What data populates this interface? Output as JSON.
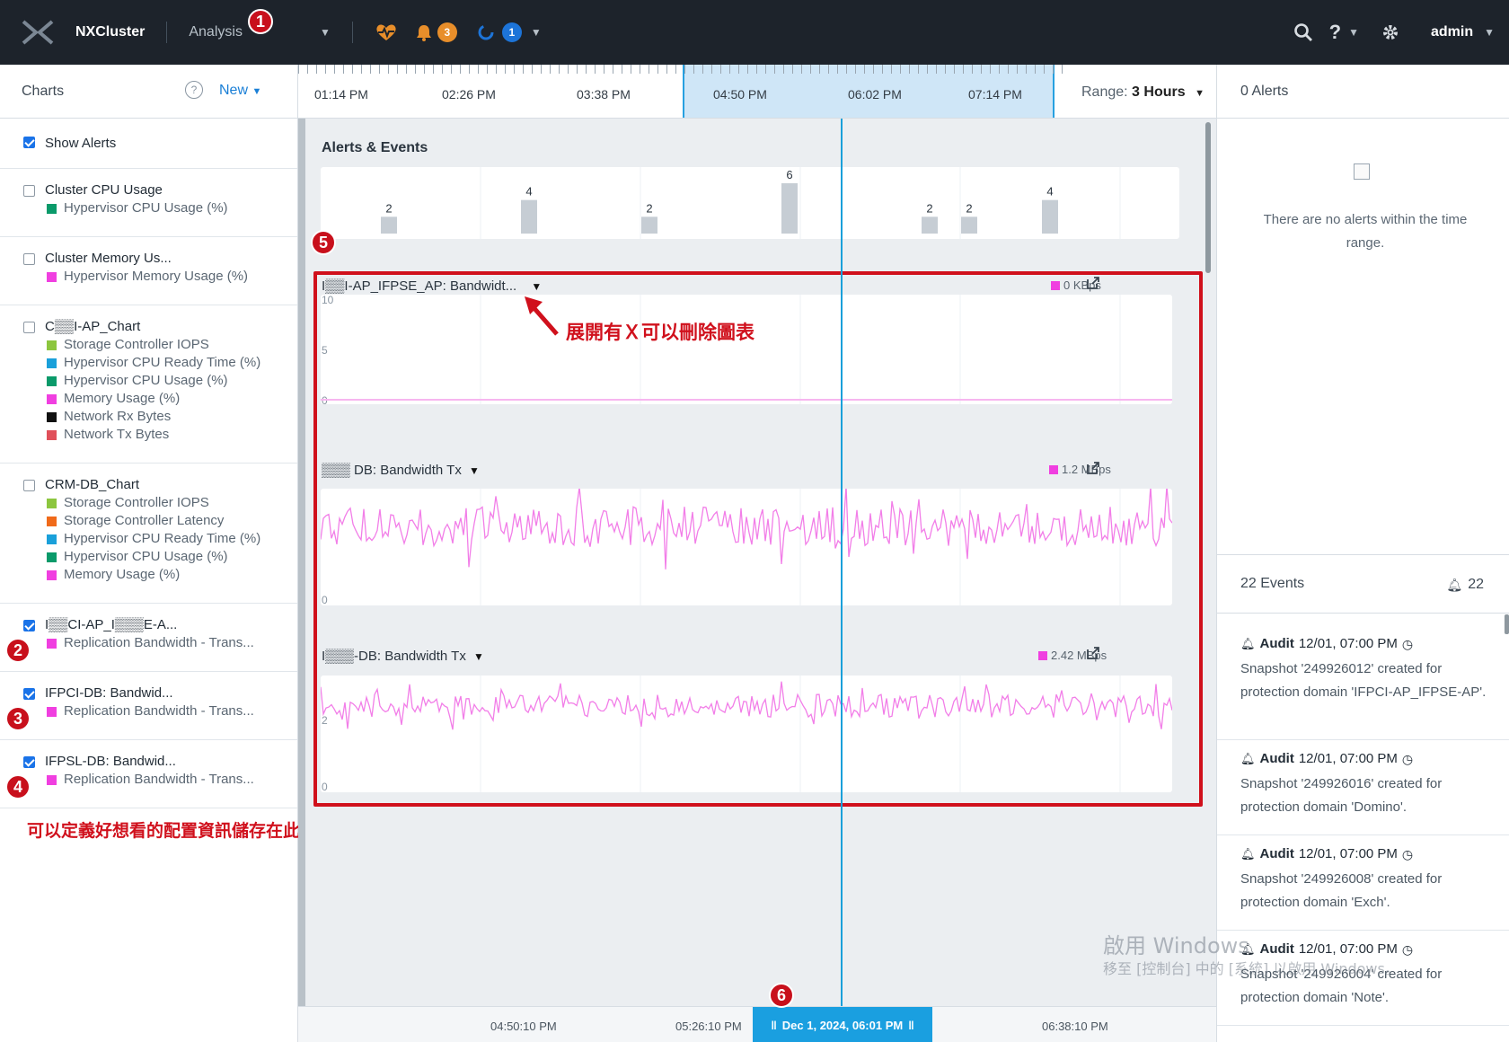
{
  "nav": {
    "cluster": "NXCluster",
    "section": "Analysis",
    "alerts_count": "3",
    "tasks_count": "1",
    "user": "admin",
    "colors": {
      "bg": "#1d232b",
      "alert_badge": "#e88e2a",
      "task_badge": "#1d74d8",
      "pulse": "#e88e2a"
    }
  },
  "callouts": [
    "1",
    "2",
    "3",
    "4",
    "5",
    "6"
  ],
  "sidebar": {
    "title": "Charts",
    "new_label": "New",
    "show_alerts": {
      "label": "Show Alerts",
      "checked": true
    },
    "groups": [
      {
        "title": "Cluster CPU Usage",
        "checked": false,
        "metrics": [
          {
            "label": "Hypervisor CPU Usage (%)",
            "color": "#0a9a6a"
          }
        ]
      },
      {
        "title": "Cluster Memory Us...",
        "checked": false,
        "metrics": [
          {
            "label": "Hypervisor Memory Usage (%)",
            "color": "#f03fe0"
          }
        ]
      },
      {
        "title": "C▒▒I-AP_Chart",
        "checked": false,
        "metrics": [
          {
            "label": "Storage Controller IOPS",
            "color": "#8cc63f"
          },
          {
            "label": "Hypervisor CPU Ready Time (%)",
            "color": "#1aa0da"
          },
          {
            "label": "Hypervisor CPU Usage (%)",
            "color": "#0a9a6a"
          },
          {
            "label": "Memory Usage (%)",
            "color": "#f03fe0"
          },
          {
            "label": "Network Rx Bytes",
            "color": "#111111"
          },
          {
            "label": "Network Tx Bytes",
            "color": "#e0505a"
          }
        ]
      },
      {
        "title": "CRM-DB_Chart",
        "checked": false,
        "metrics": [
          {
            "label": "Storage Controller IOPS",
            "color": "#8cc63f"
          },
          {
            "label": "Storage Controller Latency",
            "color": "#f06a1a"
          },
          {
            "label": "Hypervisor CPU Ready Time (%)",
            "color": "#1aa0da"
          },
          {
            "label": "Hypervisor CPU Usage (%)",
            "color": "#0a9a6a"
          },
          {
            "label": "Memory Usage (%)",
            "color": "#f03fe0"
          }
        ]
      },
      {
        "title": "I▒▒CI-AP_I▒▒▒E-A...",
        "checked": true,
        "metrics": [
          {
            "label": "Replication Bandwidth - Trans...",
            "color": "#f03fe0"
          }
        ]
      },
      {
        "title": "IFPCI-DB: Bandwid...",
        "checked": true,
        "metrics": [
          {
            "label": "Replication Bandwidth - Trans...",
            "color": "#f03fe0"
          }
        ]
      },
      {
        "title": "IFPSL-DB: Bandwid...",
        "checked": true,
        "metrics": [
          {
            "label": "Replication Bandwidth - Trans...",
            "color": "#f03fe0"
          }
        ]
      }
    ],
    "note": "可以定義好想看的配置資訊儲存在此，需要查看時再打勾"
  },
  "timeline": {
    "labels": [
      "01:14 PM",
      "02:26 PM",
      "03:38 PM",
      "04:50 PM",
      "06:02 PM",
      "07:14 PM"
    ],
    "range_label": "Range:",
    "range_value": "3 Hours"
  },
  "alerts_events": {
    "title": "Alerts & Events",
    "bars": [
      2,
      4,
      2,
      6,
      2,
      2,
      4
    ]
  },
  "charts": [
    {
      "title": "I▒▒I-AP_IFPSE_AP: Bandwidt...",
      "legend": "0 KBps",
      "ymax": "10",
      "ymid": "5",
      "ymin": "0"
    },
    {
      "title": "▒▒▒ DB: Bandwidth Tx",
      "legend": "1.2 MBps",
      "ymin": "0"
    },
    {
      "title": "I▒▒▒-DB: Bandwidth Tx",
      "legend": "2.42 MBps",
      "ymid": "2",
      "ymin": "0"
    }
  ],
  "annotation": "展開有Ｘ可以刪除圖表",
  "bottom_axis": {
    "labels": [
      "04:50:10 PM",
      "05:26:10 PM",
      "06:38:10 PM"
    ],
    "cursor": "Dec 1, 2024, 06:01 PM"
  },
  "right_panel": {
    "alerts_title": "0 Alerts",
    "no_alerts": "There are no alerts within the time range.",
    "events_title": "22 Events",
    "events_count": "22",
    "events": [
      {
        "type": "Audit",
        "time": "12/01, 07:00 PM",
        "text": "Snapshot '249926012' created for protection domain 'IFPCI-AP_IFPSE-AP'."
      },
      {
        "type": "Audit",
        "time": "12/01, 07:00 PM",
        "text": "Snapshot '249926016' created for protection domain 'Domino'."
      },
      {
        "type": "Audit",
        "time": "12/01, 07:00 PM",
        "text": "Snapshot '249926008' created for protection domain 'Exch'."
      },
      {
        "type": "Audit",
        "time": "12/01, 07:00 PM",
        "text": "Snapshot '249926004' created for protection domain 'Note'."
      }
    ]
  },
  "watermark": {
    "line1": "啟用 Windows",
    "line2": "移至 [控制台] 中的 [系統] 以啟用 Windows。"
  }
}
